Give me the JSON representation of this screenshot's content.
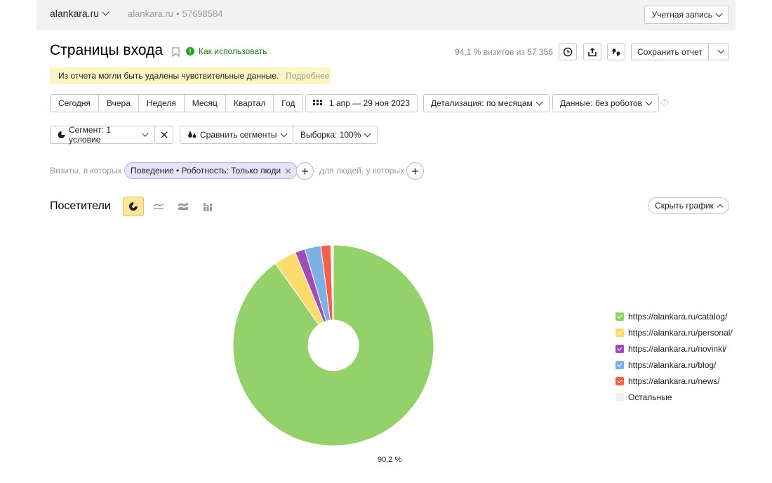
{
  "topbar": {
    "site": "alankara.ru",
    "meta_site": "alankara.ru",
    "meta_sep": "•",
    "meta_id": "57698584",
    "account_label": "Учетная запись"
  },
  "header": {
    "title": "Страницы входа",
    "howto_label": "Как использовать",
    "visits_info": "94,1 % визитов из 57 356",
    "save_label": "Сохранить отчет"
  },
  "notice": {
    "text": "Из отчета могли быть удалены чувствительные данные.",
    "more": "Подробнее"
  },
  "periods": [
    "Сегодня",
    "Вчера",
    "Неделя",
    "Месяц",
    "Квартал",
    "Год"
  ],
  "date_range": "1 апр — 29 ноя 2023",
  "detail_label": "Детализация: по месяцам",
  "data_label": "Данные: без роботов",
  "help_glyph": "?",
  "segment": {
    "label": "Сегмент: 1 условие",
    "compare_label": "Сравнить сегменты",
    "sample_label": "Выборка: 100%"
  },
  "filters": {
    "visits_label": "Визиты, в которых",
    "chip_label": "Поведение • Роботность: Только люди",
    "people_label": "для людей, у которых",
    "plus_glyph": "+"
  },
  "chart_section": {
    "title": "Посетители",
    "hide_label": "Скрыть график"
  },
  "chart_data": {
    "type": "pie",
    "slices": [
      {
        "label": "https://alankara.ru/catalog/",
        "value": 90.2,
        "color": "#95d16b"
      },
      {
        "label": "https://alankara.ru/personal/",
        "value": 3.6,
        "color": "#f9dc6d"
      },
      {
        "label": "https://alankara.ru/novinki/",
        "value": 1.6,
        "color": "#a24db5"
      },
      {
        "label": "https://alankara.ru/blog/",
        "value": 2.6,
        "color": "#7db0e5"
      },
      {
        "label": "https://alankara.ru/news/",
        "value": 1.6,
        "color": "#f6604a"
      },
      {
        "label": "Остальные",
        "value": 0.4,
        "color": "#f0f0f0"
      }
    ],
    "donut": true,
    "data_label": "90,2 %",
    "legend_position": "right"
  }
}
